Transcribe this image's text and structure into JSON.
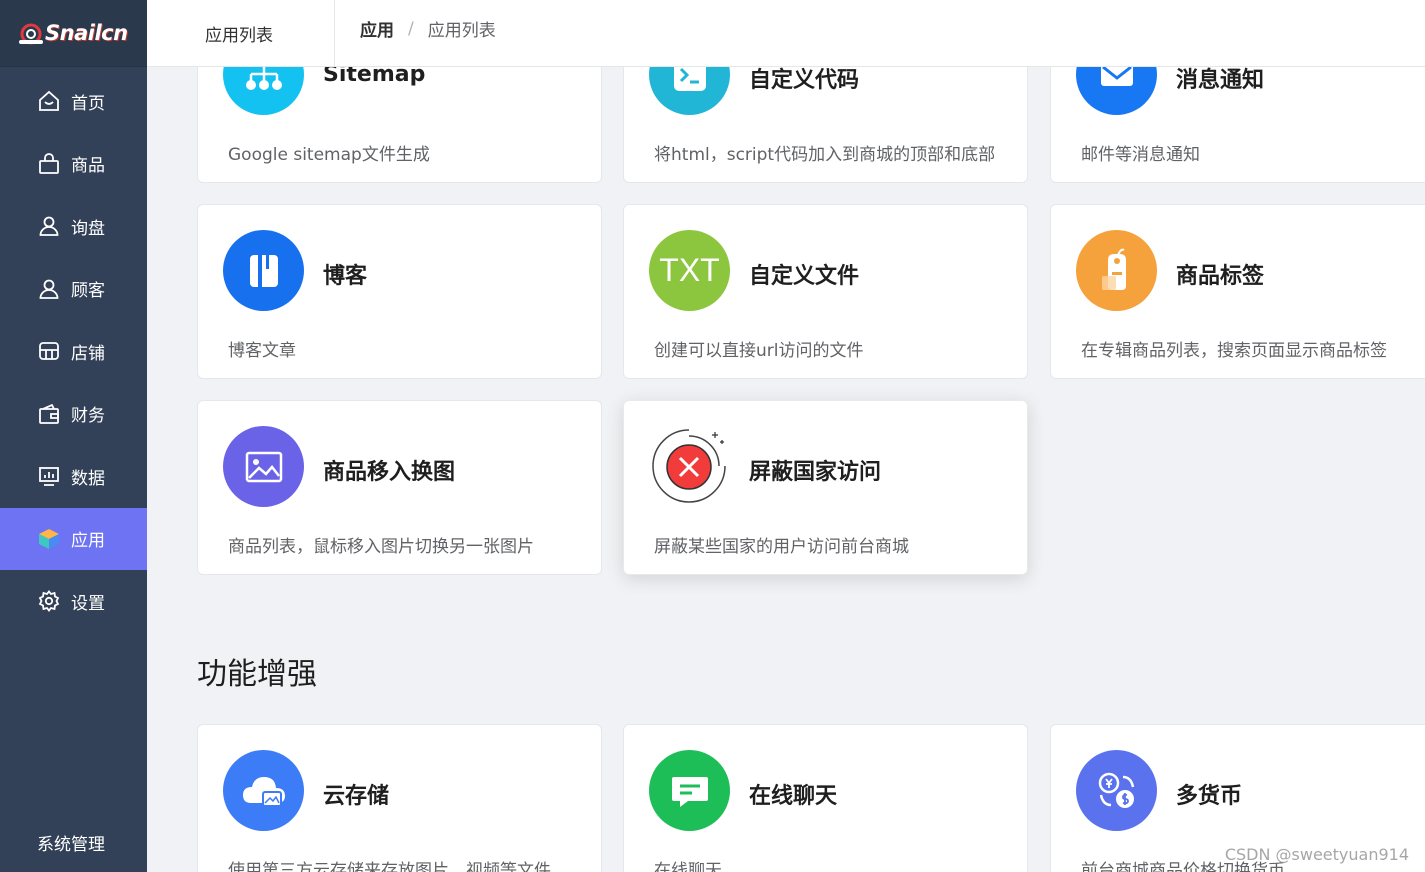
{
  "brand": {
    "logo_text": "Snailcn"
  },
  "nav": {
    "items": [
      {
        "label": "首页",
        "icon": "home-icon"
      },
      {
        "label": "商品",
        "icon": "bag-icon"
      },
      {
        "label": "询盘",
        "icon": "user-icon"
      },
      {
        "label": "顾客",
        "icon": "user-icon"
      },
      {
        "label": "店铺",
        "icon": "store-icon"
      },
      {
        "label": "财务",
        "icon": "wallet-icon"
      },
      {
        "label": "数据",
        "icon": "chart-icon"
      },
      {
        "label": "应用",
        "icon": "box-icon",
        "active": true
      },
      {
        "label": "设置",
        "icon": "gear-icon"
      }
    ],
    "system": "系统管理"
  },
  "header": {
    "tab": "应用列表",
    "breadcrumb": [
      "应用",
      "/",
      "应用列表"
    ]
  },
  "apps": [
    {
      "title": "Sitemap",
      "desc": "Google sitemap文件生成",
      "icon": "sitemap-icon",
      "color": "#13c2f0"
    },
    {
      "title": "自定义代码",
      "desc": "将html，script代码加入到商城的顶部和底部",
      "icon": "terminal-icon",
      "color": "#22b6d6"
    },
    {
      "title": "消息通知",
      "desc": "邮件等消息通知",
      "icon": "mail-icon",
      "color": "#1877f2"
    },
    {
      "title": "博客",
      "desc": "博客文章",
      "icon": "book-icon",
      "color": "#1771ef"
    },
    {
      "title": "自定义文件",
      "desc": "创建可以直接url访问的文件",
      "icon": "txt-file-icon",
      "icon_text": "TXT",
      "color": "#8cc63f"
    },
    {
      "title": "商品标签",
      "desc": "在专辑商品列表，搜索页面显示商品标签",
      "icon": "tag-icon",
      "color": "#f5a13c"
    },
    {
      "title": "商品移入换图",
      "desc": "商品列表，鼠标移入图片切换另一张图片",
      "icon": "image-icon",
      "color": "#6a63e8"
    },
    {
      "title": "屏蔽国家访问",
      "desc": "屏蔽某些国家的用户访问前台商城",
      "icon": "block-icon",
      "color": "#f23c3c"
    }
  ],
  "section": {
    "title": "功能增强"
  },
  "enhance": [
    {
      "title": "云存储",
      "desc": "使用第三方云存储来存放图片，视频等文件",
      "icon": "cloud-icon",
      "color": "#3c7cf6"
    },
    {
      "title": "在线聊天",
      "desc": "在线聊天",
      "icon": "chat-icon",
      "color": "#1dbd57"
    },
    {
      "title": "多货币",
      "desc": "前台商城商品价格切换货币",
      "icon": "currency-icon",
      "color": "#5a72ee"
    }
  ],
  "watermark": "CSDN @sweetyuan914"
}
